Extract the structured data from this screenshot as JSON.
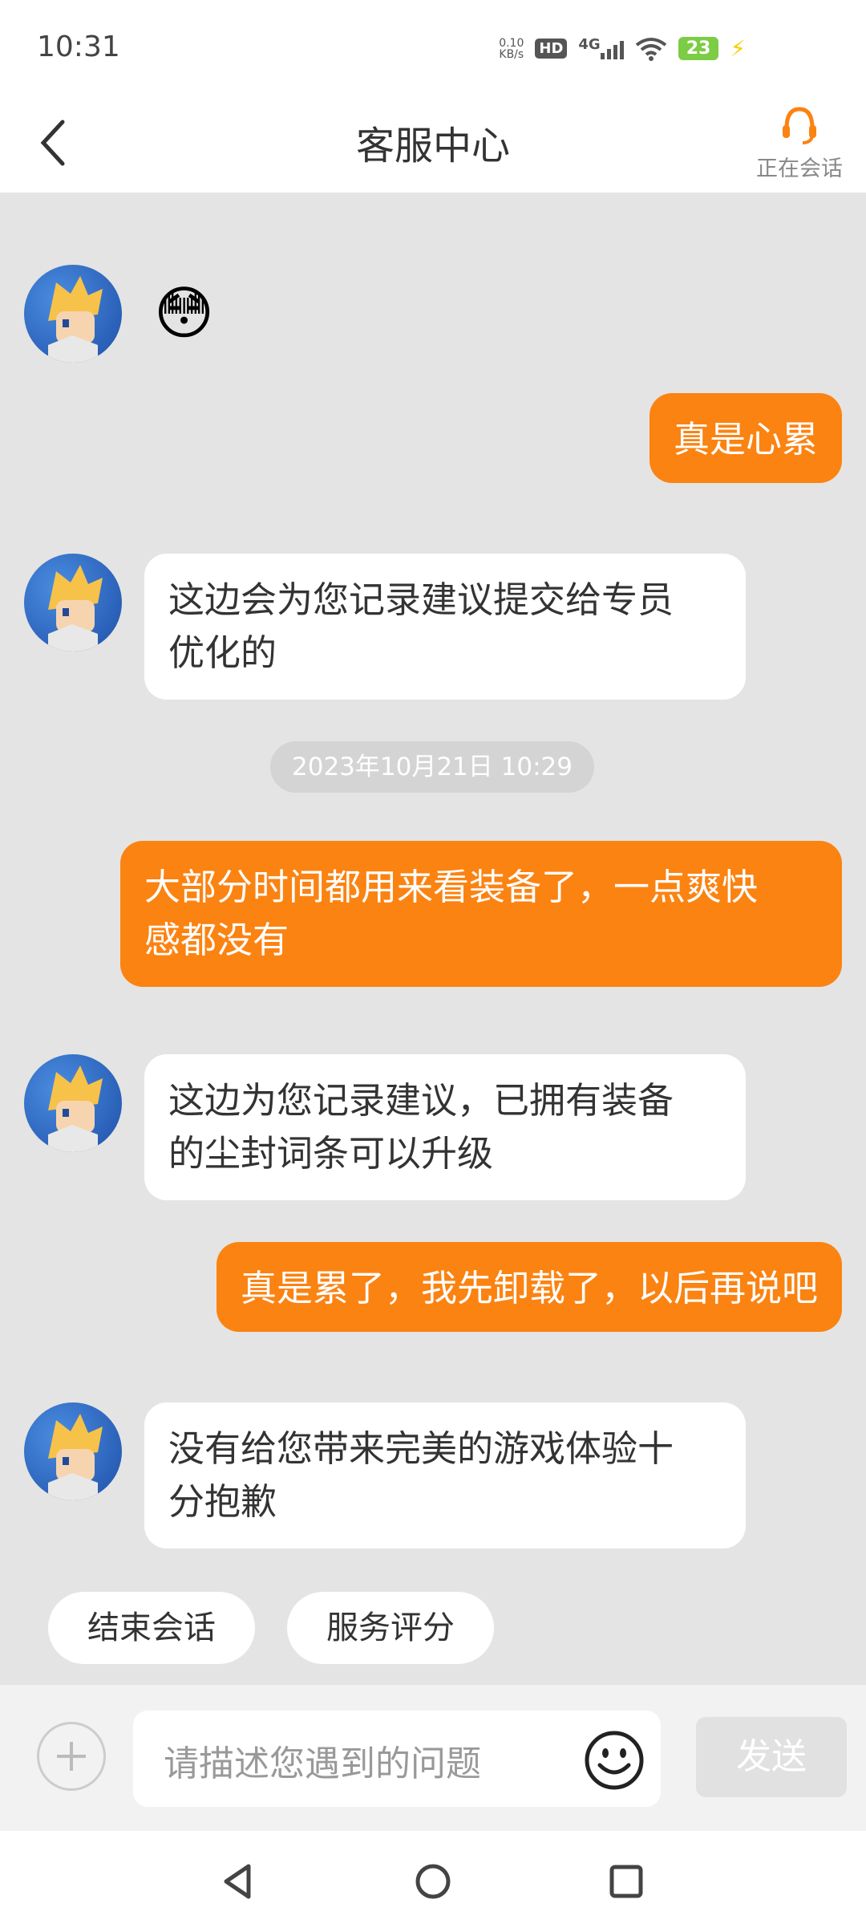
{
  "status_bar": {
    "time": "10:31",
    "net_speed_value": "0.10",
    "net_speed_unit": "KB/s",
    "hd": "HD",
    "network": "4G",
    "battery": "23"
  },
  "header": {
    "title": "客服中心",
    "session_status": "正在会话"
  },
  "messages": [
    {
      "from": "agent",
      "type": "emoji",
      "content": "😳"
    },
    {
      "from": "user",
      "text": "真是心累"
    },
    {
      "from": "agent",
      "line1": "这边会为您记录建议提交给专员",
      "line2": "优化的"
    },
    {
      "from": "system",
      "timestamp": "2023年10月21日 10:29"
    },
    {
      "from": "user",
      "line1": "大部分时间都用来看装备了，一点爽快",
      "line2": "感都没有"
    },
    {
      "from": "agent",
      "line1": "这边为您记录建议，已拥有装备",
      "line2": "的尘封词条可以升级"
    },
    {
      "from": "user",
      "text": "真是累了，我先卸载了，以后再说吧"
    },
    {
      "from": "agent",
      "line1": "没有给您带来完美的游戏体验十",
      "line2": "分抱歉"
    }
  ],
  "quick_actions": [
    "结束会话",
    "服务评分"
  ],
  "input": {
    "placeholder": "请描述您遇到的问题",
    "send_label": "发送"
  },
  "colors": {
    "accent": "#fb8312",
    "background": "#e4e4e4",
    "agent_bubble": "#ffffff"
  },
  "icons": [
    "back-arrow-icon",
    "headset-icon",
    "plus-icon",
    "smiley-icon",
    "nav-back-icon",
    "nav-home-icon",
    "nav-recents-icon"
  ]
}
